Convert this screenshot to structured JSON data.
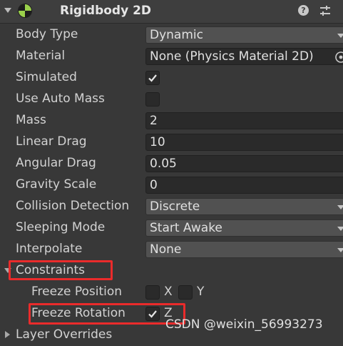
{
  "component": {
    "title": "Rigidbody 2D",
    "icon": "rigidbody-2d-icon",
    "help_glyph": "?"
  },
  "properties": {
    "body_type": {
      "label": "Body Type",
      "value": "Dynamic"
    },
    "material": {
      "label": "Material",
      "value": "None (Physics Material 2D)"
    },
    "simulated": {
      "label": "Simulated",
      "checked": true
    },
    "use_auto_mass": {
      "label": "Use Auto Mass",
      "checked": false
    },
    "mass": {
      "label": "Mass",
      "value": "2"
    },
    "linear_drag": {
      "label": "Linear Drag",
      "value": "10"
    },
    "angular_drag": {
      "label": "Angular Drag",
      "value": "0.05"
    },
    "gravity_scale": {
      "label": "Gravity Scale",
      "value": "0"
    },
    "collision_detection": {
      "label": "Collision Detection",
      "value": "Discrete"
    },
    "sleeping_mode": {
      "label": "Sleeping Mode",
      "value": "Start Awake"
    },
    "interpolate": {
      "label": "Interpolate",
      "value": "None"
    }
  },
  "constraints": {
    "label": "Constraints",
    "expanded": true,
    "freeze_position": {
      "label": "Freeze Position",
      "x_label": "X",
      "x_checked": false,
      "y_label": "Y",
      "y_checked": false
    },
    "freeze_rotation": {
      "label": "Freeze Rotation",
      "z_label": "Z",
      "z_checked": true
    }
  },
  "layer_overrides": {
    "label": "Layer Overrides",
    "expanded": false
  },
  "watermark": "CSDN @weixin_56993273",
  "colors": {
    "background": "#383838",
    "field": "#2a2a2a",
    "dropdown": "#515151",
    "highlight": "#ea2b2b",
    "text": "#d2d2d2"
  }
}
